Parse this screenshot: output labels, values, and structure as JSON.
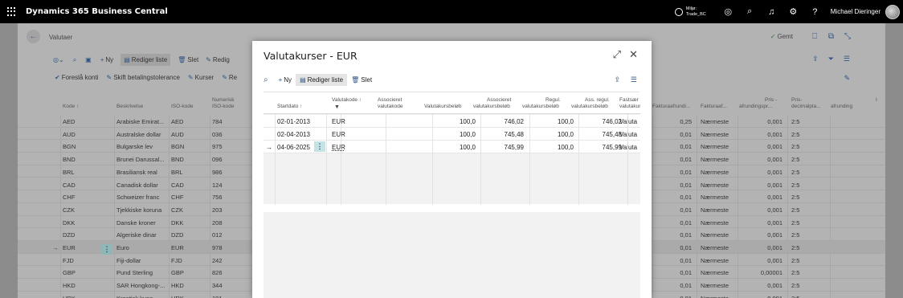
{
  "topbar": {
    "app_title": "Dynamics 365 Business Central",
    "env_line1": "Miljø:",
    "env_line2": "Trade_BC",
    "user_name": "Michael Dieringer"
  },
  "page": {
    "title": "Valutaer",
    "saved": "Gemt",
    "actions1": {
      "new": "Ny",
      "edit_list": "Rediger liste",
      "delete": "Slet",
      "edit": "Redig"
    },
    "actions2": {
      "suggest": "Foreslå konti",
      "payment_tol": "Skift betalingstolerance",
      "rates": "Kurser",
      "re": "Re"
    },
    "headers": {
      "code": "Kode ↑",
      "desc": "Beskrivelse",
      "iso": "ISO-kode",
      "iso_num_1": "Numerisk",
      "iso_num_2": "ISO-kode",
      "h1": "Fakturaafrundi...",
      "h2": "Fakturaaf...",
      "h3_1": "Pris -",
      "h3_2": "afrundingspr...",
      "h4_1": "Pris-",
      "h4_2": "decimalpla...",
      "h5_1": "I",
      "h5_2": "afrunding"
    },
    "rows": [
      {
        "code": "AED",
        "desc": "Arabiske Emirat...",
        "iso": "AED",
        "num": "784",
        "r": "0,25",
        "m": "Nærmeste",
        "p": "0,001",
        "d": "2:5"
      },
      {
        "code": "AUD",
        "desc": "Australske dollar",
        "iso": "AUD",
        "num": "036",
        "r": "0,01",
        "m": "Nærmeste",
        "p": "0,001",
        "d": "2:5"
      },
      {
        "code": "BGN",
        "desc": "Bulgarske lev",
        "iso": "BGN",
        "num": "975",
        "r": "0,01",
        "m": "Nærmeste",
        "p": "0,001",
        "d": "2:5"
      },
      {
        "code": "BND",
        "desc": "Brunei Darussal...",
        "iso": "BND",
        "num": "096",
        "r": "0,01",
        "m": "Nærmeste",
        "p": "0,001",
        "d": "2:5"
      },
      {
        "code": "BRL",
        "desc": "Brasiliansk real",
        "iso": "BRL",
        "num": "986",
        "r": "0,01",
        "m": "Nærmeste",
        "p": "0,001",
        "d": "2:5"
      },
      {
        "code": "CAD",
        "desc": "Canadisk dollar",
        "iso": "CAD",
        "num": "124",
        "r": "0,01",
        "m": "Nærmeste",
        "p": "0,001",
        "d": "2:5"
      },
      {
        "code": "CHF",
        "desc": "Schweizer franc",
        "iso": "CHF",
        "num": "756",
        "r": "0,01",
        "m": "Nærmeste",
        "p": "0,001",
        "d": "2:5"
      },
      {
        "code": "CZK",
        "desc": "Tjekkiske koruna",
        "iso": "CZK",
        "num": "203",
        "r": "0,01",
        "m": "Nærmeste",
        "p": "0,001",
        "d": "2:5"
      },
      {
        "code": "DKK",
        "desc": "Danske kroner",
        "iso": "DKK",
        "num": "208",
        "r": "0,01",
        "m": "Nærmeste",
        "p": "0,001",
        "d": "2:5"
      },
      {
        "code": "DZD",
        "desc": "Algeriske dinar",
        "iso": "DZD",
        "num": "012",
        "r": "0,01",
        "m": "Nærmeste",
        "p": "0,001",
        "d": "2:5"
      },
      {
        "code": "EUR",
        "desc": "Euro",
        "iso": "EUR",
        "num": "978",
        "r": "0,01",
        "m": "Nærmeste",
        "p": "0,001",
        "d": "2:5"
      },
      {
        "code": "FJD",
        "desc": "Fiji-dollar",
        "iso": "FJD",
        "num": "242",
        "r": "0,01",
        "m": "Nærmeste",
        "p": "0,001",
        "d": "2:5"
      },
      {
        "code": "GBP",
        "desc": "Pund Sterling",
        "iso": "GBP",
        "num": "826",
        "r": "0,01",
        "m": "Nærmeste",
        "p": "0,00001",
        "d": "2:5"
      },
      {
        "code": "HKD",
        "desc": "SAR Hongkong-...",
        "iso": "HKD",
        "num": "344",
        "r": "0,01",
        "m": "Nærmeste",
        "p": "0,001",
        "d": "2:5"
      },
      {
        "code": "HRK",
        "desc": "Kroatisk kuna",
        "iso": "HRK",
        "num": "191",
        "r": "0,01",
        "m": "Nærmeste",
        "p": "0,001",
        "d": "2:5"
      }
    ],
    "current_row_mark": "→"
  },
  "modal": {
    "title": "Valutakurser - EUR",
    "actions": {
      "new": "Ny",
      "edit_list": "Rediger liste",
      "delete": "Slet"
    },
    "headers": {
      "start": "Startdato ↑",
      "code": "Valutakode ↑",
      "assoc_1": "Associeret",
      "assoc_2": "valutakode",
      "amount": "Valutakursbeløb",
      "assoc_amt_1": "Associeret",
      "assoc_amt_2": "valutakursbeløb",
      "adj_1": "Regul.",
      "adj_2": "valutakursbeløb",
      "ass_adj_1": "Ass. regul.",
      "ass_adj_2": "valutakursbeløb",
      "fixed_1": "Fastsær",
      "fixed_2": "valutakur"
    },
    "rows": [
      {
        "start": "02-01-2013",
        "code": "EUR",
        "amount": "100,0",
        "assoc": "746,02",
        "adj": "100,0",
        "ass_adj": "746,02",
        "fixed": "Valuta"
      },
      {
        "start": "02-04-2013",
        "code": "EUR",
        "amount": "100,0",
        "assoc": "745,48",
        "adj": "100,0",
        "ass_adj": "745,48",
        "fixed": "Valuta"
      },
      {
        "start": "04-06-2025",
        "code": "EUR",
        "amount": "100,0",
        "assoc": "745,99",
        "adj": "100,0",
        "ass_adj": "745,99",
        "fixed": "Valuta"
      }
    ],
    "current_row_mark": "→"
  }
}
